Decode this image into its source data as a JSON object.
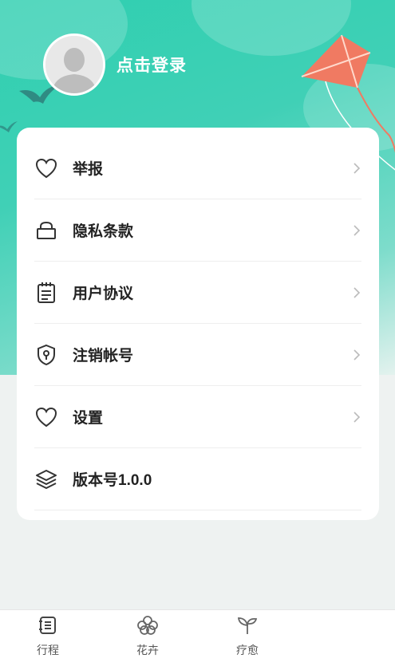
{
  "profile": {
    "login_text": "点击登录"
  },
  "menu": [
    {
      "label": "举报",
      "icon": "heart-icon"
    },
    {
      "label": "隐私条款",
      "icon": "lock-icon"
    },
    {
      "label": "用户协议",
      "icon": "notepad-icon"
    },
    {
      "label": "注销帐号",
      "icon": "shield-key-icon"
    },
    {
      "label": "设置",
      "icon": "heart-icon"
    },
    {
      "label": "版本号1.0.0",
      "icon": "layers-icon"
    }
  ],
  "tabs": [
    {
      "label": "行程",
      "icon": "itinerary-icon"
    },
    {
      "label": "花卉",
      "icon": "flower-icon"
    },
    {
      "label": "疗愈",
      "icon": "sprout-icon"
    }
  ],
  "colors": {
    "accent": "#2fcfb0",
    "kite": "#f07a62"
  }
}
